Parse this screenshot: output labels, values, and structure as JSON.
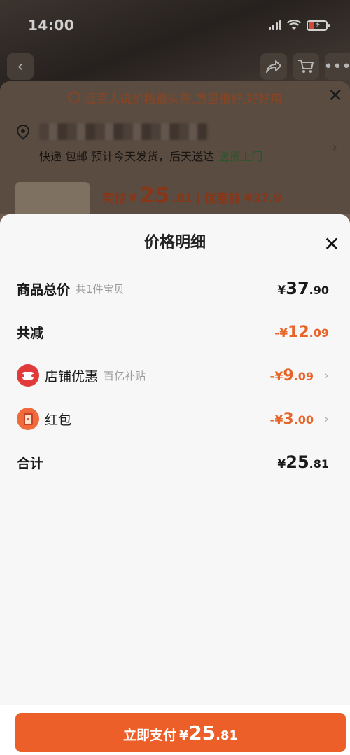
{
  "status_bar": {
    "time": "14:00"
  },
  "background_page": {
    "promo_text": "近百人说价格很实惠,质量很好,好好用",
    "close_label": "✕",
    "shipping": {
      "text": "快递 包邮 预计今天发货，后天送达",
      "highlight": "送货上门"
    },
    "price": {
      "paid_label": "实付",
      "currency": "¥",
      "paid_int": "25",
      "paid_dec": ".81",
      "before_label": "| 优惠前 ¥37.9"
    }
  },
  "sheet": {
    "title": "价格明细",
    "close_label": "✕",
    "rows": [
      {
        "label": "商品总价",
        "sub": "共1件宝贝",
        "cur": "¥",
        "int": "37",
        "dec": ".90"
      },
      {
        "label": "共减",
        "cur": "-¥",
        "int": "12",
        "dec": ".09"
      },
      {
        "label": "店铺优惠",
        "sub": "百亿补贴",
        "cur": "-¥",
        "int": "9",
        "dec": ".09"
      },
      {
        "label": "红包",
        "cur": "-¥",
        "int": "3",
        "dec": ".00"
      },
      {
        "label": "合计",
        "cur": "¥",
        "int": "25",
        "dec": ".81"
      }
    ]
  },
  "pay_button": {
    "label": "立即支付",
    "cur": "¥",
    "int": "25",
    "dec": ".81"
  },
  "colors": {
    "accent": "#ec5f28",
    "discount": "#e8652a",
    "green": "#2c6b35"
  },
  "icons": [
    "back-arrow-icon",
    "share-icon",
    "cart-icon",
    "more-icon",
    "location-pin-icon",
    "coupon-icon",
    "red-packet-icon",
    "chevron-right-icon",
    "close-icon"
  ]
}
